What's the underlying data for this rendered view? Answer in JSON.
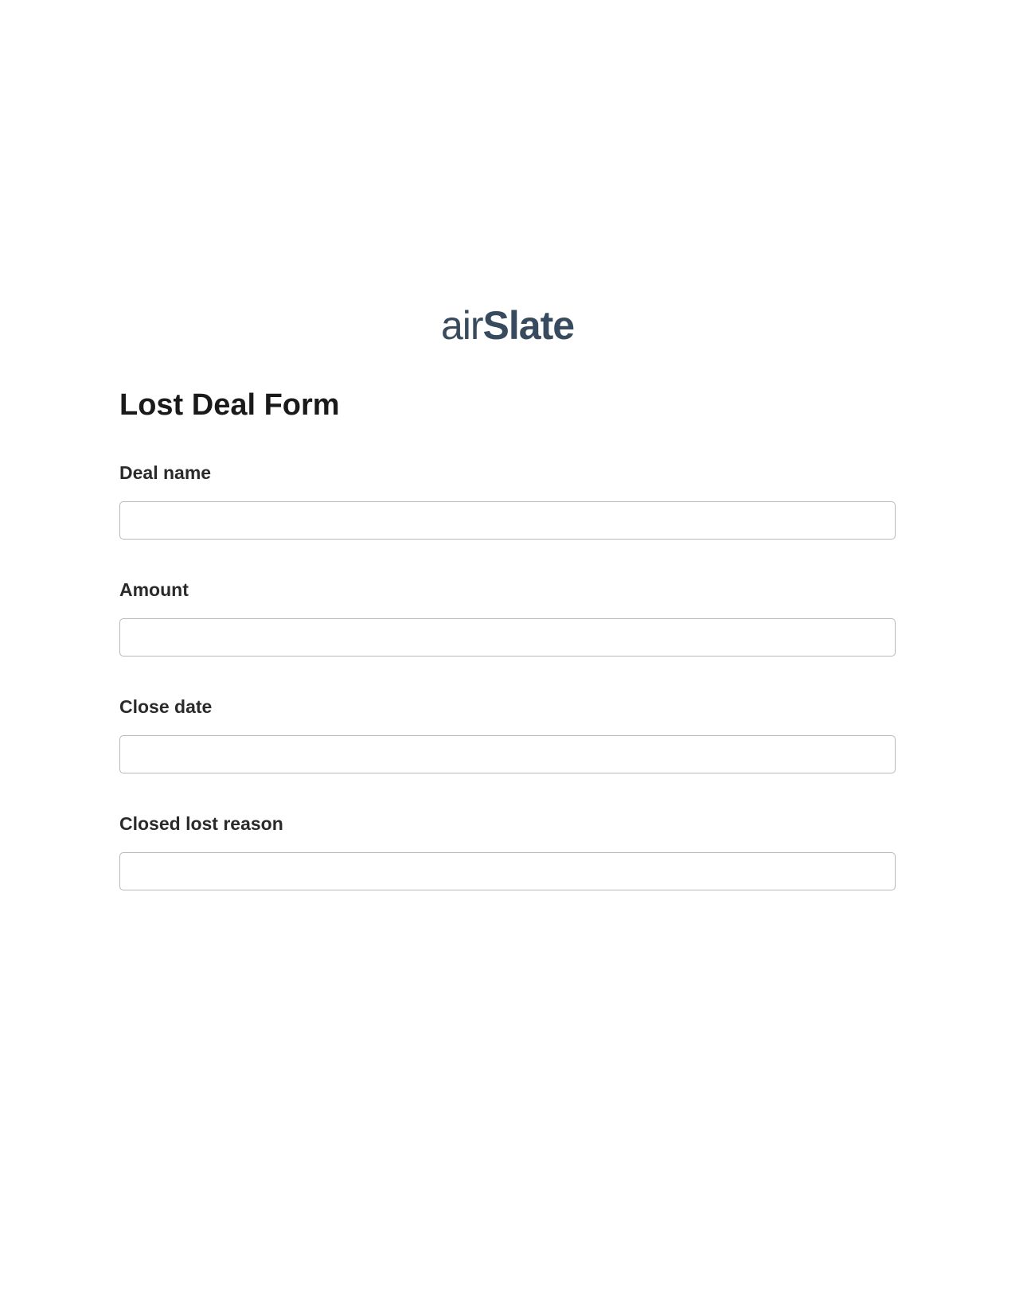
{
  "logo": {
    "part1": "air",
    "part2": "Slate"
  },
  "form": {
    "title": "Lost Deal Form",
    "fields": [
      {
        "label": "Deal name",
        "value": ""
      },
      {
        "label": "Amount",
        "value": ""
      },
      {
        "label": "Close date",
        "value": ""
      },
      {
        "label": "Closed lost reason",
        "value": ""
      }
    ]
  }
}
